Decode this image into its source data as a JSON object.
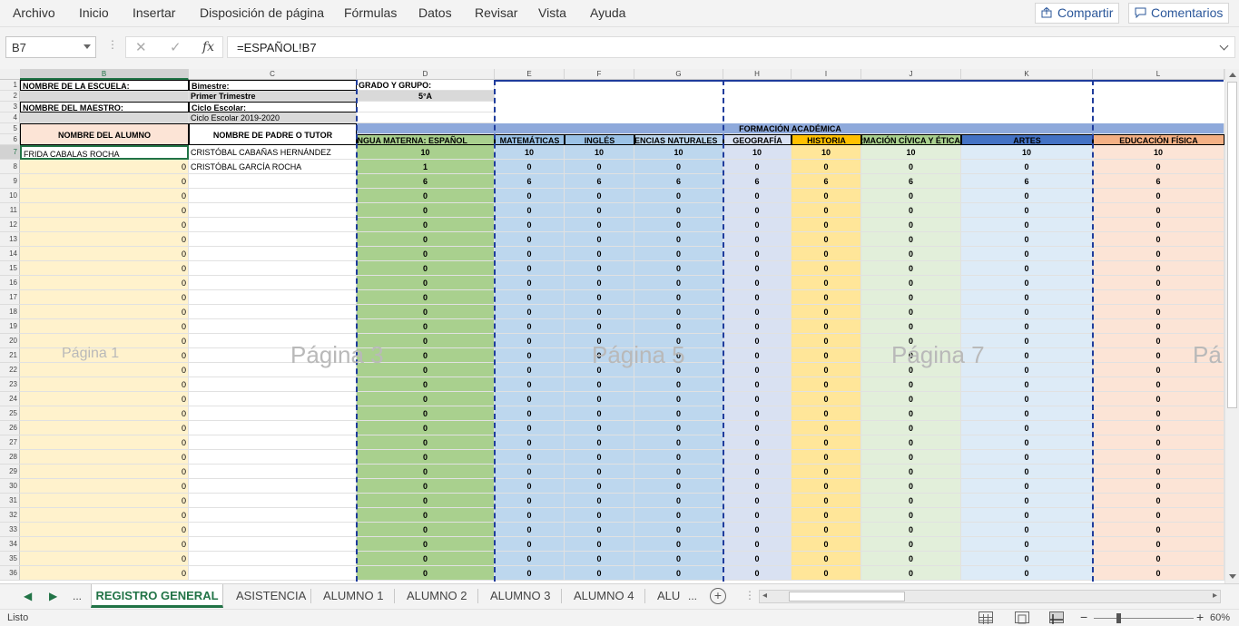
{
  "ribbon": {
    "tabs": [
      "Archivo",
      "Inicio",
      "Insertar",
      "Disposición de página",
      "Fórmulas",
      "Datos",
      "Revisar",
      "Vista",
      "Ayuda"
    ],
    "share_label": "Compartir",
    "comments_label": "Comentarios"
  },
  "formula_bar": {
    "name_box": "B7",
    "formula": "=ESPAÑOL!B7",
    "fx_label": "fx"
  },
  "columns": [
    "B",
    "C",
    "D",
    "E",
    "F",
    "G",
    "H",
    "I",
    "J",
    "K",
    "L"
  ],
  "selected_column": "B",
  "selected_row": 7,
  "rows": [
    1,
    2,
    3,
    4,
    5,
    6,
    7,
    8,
    9,
    10,
    11,
    12,
    13,
    14,
    15,
    16,
    17,
    18,
    19,
    20,
    21,
    22,
    23,
    24,
    25,
    26,
    27,
    28,
    29,
    30,
    31,
    32,
    33,
    34,
    35,
    36
  ],
  "header_info": {
    "school_label": "NOMBRE DE LA ESCUELA:",
    "teacher_label": "NOMBRE DEL MAESTRO:",
    "bimestre_label": "Bimestre:",
    "trimestre": "Primer Trimestre",
    "ciclo_label": "Ciclo Escolar:",
    "ciclo_value": "Ciclo Escolar 2019-2020",
    "grado_label": "GRADO Y GRUPO:",
    "grado_value": "5°A"
  },
  "table_headers": {
    "student": "NOMBRE DEL ALUMNO",
    "tutor": "NOMBRE DE PADRE O TUTOR",
    "formacion": "FORMACIÓN ACADÉMICA",
    "subjects": [
      "LENGUA MATERNA: ESPAÑOL",
      "MATEMÁTICAS",
      "INGLÉS",
      "CIENCIAS NATURALES",
      "GEOGRAFÍA",
      "HISTORIA",
      "FORMACIÓN CÍVICA Y ÉTICA",
      "ARTES",
      "EDUCACIÓN FÍSICA"
    ]
  },
  "records": [
    {
      "student": "FRIDA CABALAS ROCHA",
      "tutor": "CRISTÓBAL CABAÑAS HERNÁNDEZ",
      "grades": [
        "10",
        "10",
        "10",
        "10",
        "10",
        "10",
        "10",
        "10",
        "10"
      ]
    },
    {
      "student": "0",
      "tutor": "CRISTÓBAL GARCÍA ROCHA",
      "grades": [
        "1",
        "0",
        "0",
        "0",
        "0",
        "0",
        "0",
        "0",
        "0"
      ]
    },
    {
      "student": "0",
      "tutor": "",
      "grades": [
        "6",
        "6",
        "6",
        "6",
        "6",
        "6",
        "6",
        "6",
        "6"
      ]
    }
  ],
  "filler_value": "0",
  "page_watermarks": [
    "Página 1",
    "Página 3",
    "Página 5",
    "Página 7",
    "Pá"
  ],
  "sheet_tabs": [
    "REGISTRO GENERAL",
    "ASISTENCIA",
    "ALUMNO 1",
    "ALUMNO 2",
    "ALUMNO 3",
    "ALUMNO 4",
    "ALU"
  ],
  "active_sheet": "REGISTRO GENERAL",
  "status": {
    "text": "Listo",
    "zoom": "60%",
    "zoom_minus": "−",
    "zoom_plus": "+"
  },
  "colors": {
    "spanish": "#a9d08e",
    "math": "#bdd7ee",
    "english": "#9bc2e6",
    "science": "#bdd7ee",
    "geography": "#d9e1f2",
    "history": "#ffe699",
    "civics": "#e2efda",
    "arts": "#ddebf7",
    "pe": "#fce4d6",
    "student_col": "#fff2cc",
    "accent": "#217346"
  }
}
